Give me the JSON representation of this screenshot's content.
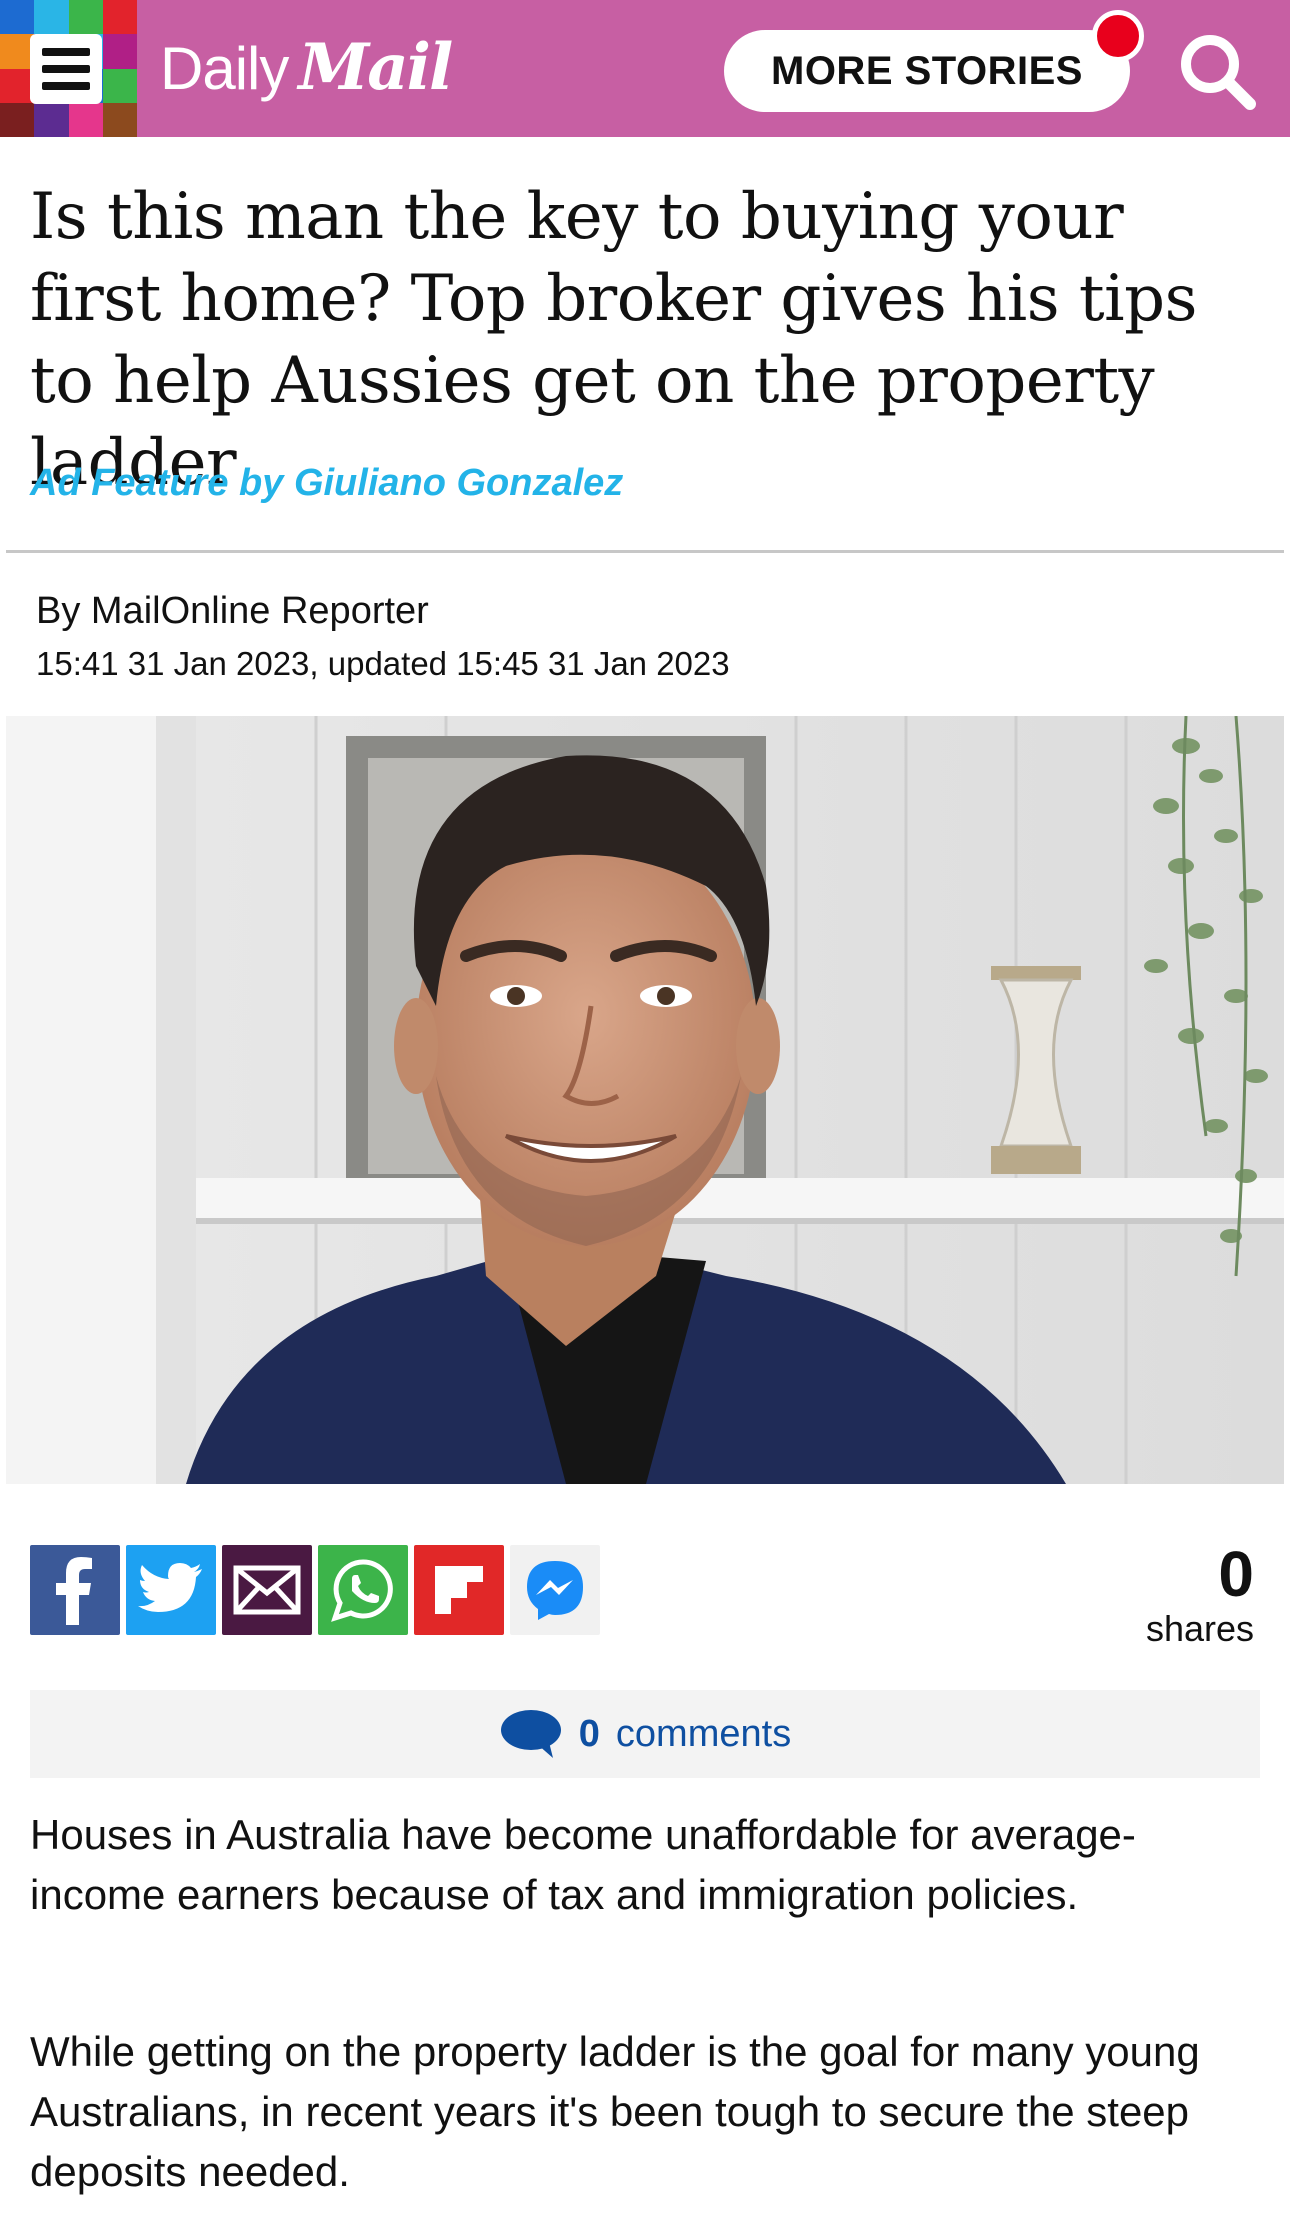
{
  "header": {
    "brand_daily": "Daily",
    "brand_mail": "Mail",
    "more_stories_label": "MORE STORIES",
    "logo_colors": [
      "#1d6bd1",
      "#2ab5e6",
      "#3bb54a",
      "#e2232c",
      "#f08a1d",
      "#5c2c91",
      "#2ab5e6",
      "#b01f86",
      "#e2232c",
      "#f5c518",
      "#1d6bd1",
      "#3bb54a",
      "#7a1f1f",
      "#5c2c91",
      "#e5368c",
      "#8c4a1e"
    ],
    "background_color": "#c75fa3",
    "notification_color": "#e8001c",
    "menu_icon": "hamburger-menu-icon",
    "search_icon": "search-icon"
  },
  "article": {
    "headline": "Is this man the key to buying your first home? Top broker gives his tips to help Aussies get on the property ladder",
    "ad_feature": "Ad Feature by Giuliano Gonzalez",
    "byline": "By MailOnline Reporter",
    "dateline": "15:41 31 Jan 2023, updated 15:45 31 Jan 2023",
    "paragraphs": [
      "Houses in Australia have become unaffordable for average-income earners because of tax and immigration policies.",
      "While getting on the property ladder is the goal for many young Australians, in recent years it's been tough to secure the steep deposits needed."
    ]
  },
  "share": {
    "buttons": [
      {
        "name": "facebook",
        "icon": "facebook-icon",
        "color": "#3b5998"
      },
      {
        "name": "twitter",
        "icon": "twitter-icon",
        "color": "#1da1f2"
      },
      {
        "name": "email",
        "icon": "email-icon",
        "color": "#4a1942"
      },
      {
        "name": "whatsapp",
        "icon": "whatsapp-icon",
        "color": "#3cb44a"
      },
      {
        "name": "flipboard",
        "icon": "flipboard-icon",
        "color": "#e12828"
      },
      {
        "name": "messenger",
        "icon": "messenger-icon",
        "color": "#f1f1f1"
      }
    ],
    "count": "0",
    "count_label": "shares"
  },
  "comments": {
    "count": "0",
    "label": "comments",
    "color": "#0e4fa1"
  }
}
